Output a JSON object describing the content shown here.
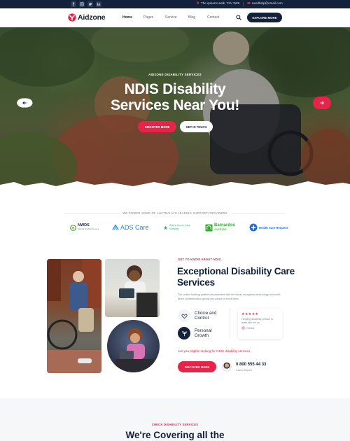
{
  "topbar": {
    "social_icons": [
      "facebook-icon",
      "instagram-icon",
      "twitter-icon",
      "linkedin-icon"
    ],
    "address": "The queens walk, T3V 3W6",
    "email": "needhelp@email.com"
  },
  "nav": {
    "logo_text": "Aidzone",
    "links": [
      "Home",
      "Pages",
      "Service",
      "Blog",
      "Contact"
    ],
    "active_link": "Home",
    "cta_label": "EXPLORE MORE"
  },
  "hero": {
    "eyebrow": "AIDZONE DISABILITY SERVICES",
    "title_line1": "NDIS Disability",
    "title_line2": "Services Near You!",
    "primary_button": "DISCOVER MORE",
    "secondary_button": "GET IN TOUCH"
  },
  "partners": {
    "label": "WE POWER SOME OF AUSTRALIA'S LEADING SUPPORT PROVIDERS",
    "logos": [
      {
        "name": "NWDS",
        "tagline": "National Disability Services"
      },
      {
        "name": "ADS Care"
      },
      {
        "name": "Star's Home Care Nursing"
      },
      {
        "name": "Barnardos",
        "sub": "Australia"
      },
      {
        "name": "Health Care Request"
      }
    ]
  },
  "about": {
    "eyebrow": "GET TO KNOW ABOUT NDIS",
    "title": "Exceptional Disability Care Services",
    "description": "Our online banking platform is protected with the latest encryption technology and multi-factor authentication giving you peace of mind when",
    "features": [
      {
        "label": "Choice and Control",
        "icon": "hands-heart-icon"
      },
      {
        "label": "Personal Growth",
        "icon": "growth-icon"
      }
    ],
    "review": {
      "stars": "★★★★★",
      "text": "Helping disability person is main aim for us",
      "author": "OSAN"
    },
    "eligible_text": "Are you eligible looking for NDIS disability services",
    "button": "DISCOVER MORE",
    "phone": "0 800 555 44 33",
    "phone_label": "Call to Expert"
  },
  "services": {
    "eyebrow": "CHECK DISABILITY SERVICES",
    "title": "We're Covering all the"
  },
  "colors": {
    "navy": "#13213b",
    "accent": "#e8234a",
    "muted": "#7a8394"
  }
}
